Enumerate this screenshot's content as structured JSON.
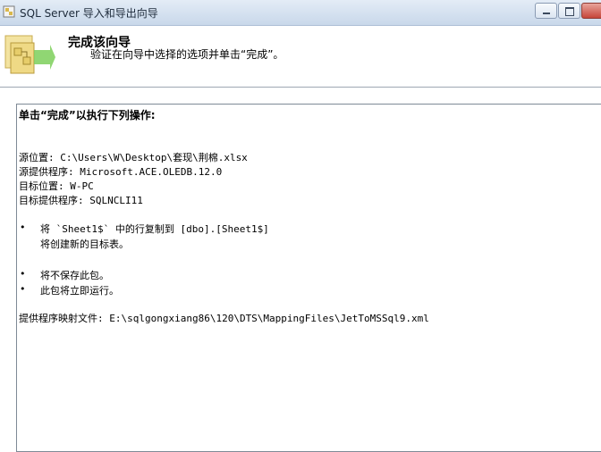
{
  "window": {
    "title": "SQL Server 导入和导出向导"
  },
  "header": {
    "title": "完成该向导",
    "subtitle": "验证在向导中选择的选项并单击“完成”。"
  },
  "summary": {
    "heading": "单击“完成”以执行下列操作:",
    "source_location": "源位置: C:\\Users\\W\\Desktop\\套现\\荆棉.xlsx",
    "source_provider": "源提供程序: Microsoft.ACE.OLEDB.12.0",
    "target_location": "目标位置: W-PC",
    "target_provider": "目标提供程序: SQLNCLI11",
    "copy_rows": "将 `Sheet1$` 中的行复制到 [dbo].[Sheet1$]",
    "create_table": "将创建新的目标表。",
    "no_save": "将不保存此包。",
    "run_now": "此包将立即运行。",
    "mapping_file": "提供程序映射文件: E:\\sqlgongxiang86\\120\\DTS\\MappingFiles\\JetToMSSql9.xml"
  },
  "colors": {
    "titlebar": "#d3e0ef",
    "panel_border": "#7f8a96"
  },
  "icons": {
    "app": "app-icon",
    "wizard": "wizard-icon",
    "minimize": "minimize-icon",
    "maximize": "maximize-icon",
    "close": "close-icon"
  }
}
